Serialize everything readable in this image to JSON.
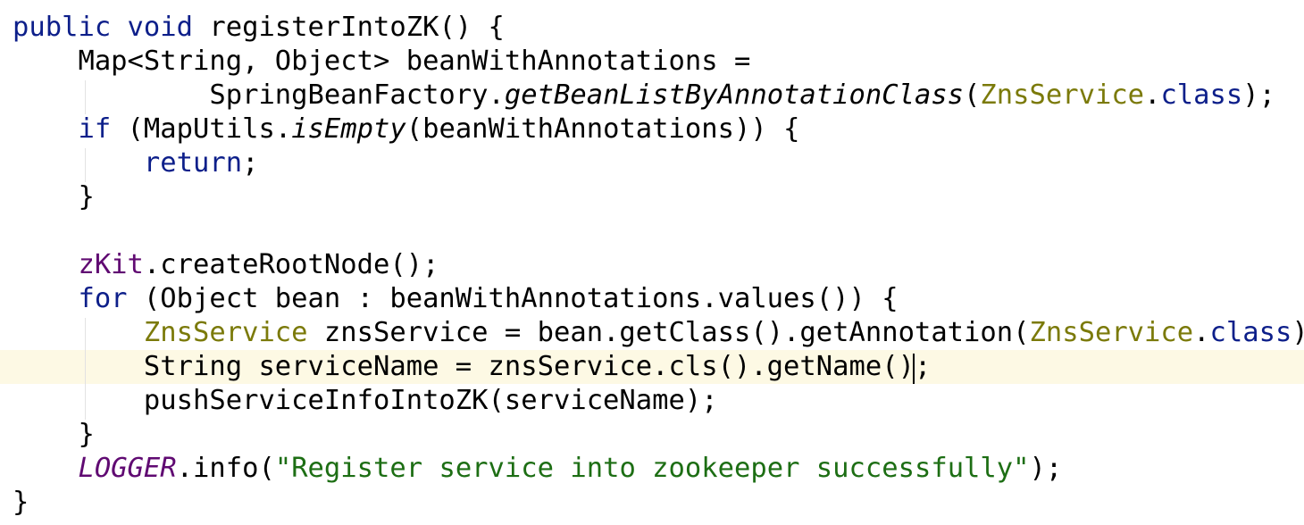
{
  "code_lines": [
    {
      "s": [
        {
          "t": "public void",
          "c": "kw"
        },
        {
          "t": " registerIntoZK() {",
          "c": ""
        }
      ]
    },
    {
      "s": [
        {
          "t": "    Map<String, Object> beanWithAnnotations =",
          "c": ""
        }
      ]
    },
    {
      "s": [
        {
          "t": "            SpringBeanFactory.",
          "c": ""
        },
        {
          "t": "getBeanListByAnnotationClass",
          "c": "it"
        },
        {
          "t": "(",
          "c": ""
        },
        {
          "t": "ZnsService",
          "c": "ann"
        },
        {
          "t": ".",
          "c": ""
        },
        {
          "t": "class",
          "c": "kw"
        },
        {
          "t": ");",
          "c": ""
        }
      ]
    },
    {
      "s": [
        {
          "t": "    ",
          "c": ""
        },
        {
          "t": "if",
          "c": "kw"
        },
        {
          "t": " (MapUtils.",
          "c": ""
        },
        {
          "t": "isEmpty",
          "c": "it"
        },
        {
          "t": "(beanWithAnnotations)) {",
          "c": ""
        }
      ]
    },
    {
      "s": [
        {
          "t": "        ",
          "c": ""
        },
        {
          "t": "return",
          "c": "kw"
        },
        {
          "t": ";",
          "c": ""
        }
      ]
    },
    {
      "s": [
        {
          "t": "    }",
          "c": ""
        }
      ]
    },
    {
      "s": [
        {
          "t": "",
          "c": ""
        }
      ]
    },
    {
      "s": [
        {
          "t": "    ",
          "c": ""
        },
        {
          "t": "zKit",
          "c": "field"
        },
        {
          "t": ".createRootNode();",
          "c": ""
        }
      ]
    },
    {
      "s": [
        {
          "t": "    ",
          "c": ""
        },
        {
          "t": "for",
          "c": "kw"
        },
        {
          "t": " (Object bean : beanWithAnnotations.values()) {",
          "c": ""
        }
      ]
    },
    {
      "s": [
        {
          "t": "        ",
          "c": ""
        },
        {
          "t": "ZnsService",
          "c": "ann"
        },
        {
          "t": " znsService = bean.getClass().getAnnotation(",
          "c": ""
        },
        {
          "t": "ZnsService",
          "c": "ann"
        },
        {
          "t": ".",
          "c": ""
        },
        {
          "t": "class",
          "c": "kw"
        },
        {
          "t": ");",
          "c": ""
        }
      ]
    },
    {
      "s": [
        {
          "t": "        String serviceName = znsService.cls().getName();",
          "c": ""
        }
      ],
      "current": true
    },
    {
      "s": [
        {
          "t": "        pushServiceInfoIntoZK(serviceName);",
          "c": ""
        }
      ]
    },
    {
      "s": [
        {
          "t": "    }",
          "c": ""
        }
      ]
    },
    {
      "s": [
        {
          "t": "    ",
          "c": ""
        },
        {
          "t": "LOGGER",
          "c": "field-it"
        },
        {
          "t": ".info(",
          "c": ""
        },
        {
          "t": "\"Register service into zookeeper successfully\"",
          "c": "str"
        },
        {
          "t": ");",
          "c": ""
        }
      ]
    },
    {
      "s": [
        {
          "t": "}",
          "c": ""
        }
      ]
    }
  ],
  "colors": {
    "keyword": "#0d1f8a",
    "annotation": "#7b7a0a",
    "string": "#1d6e14",
    "field": "#600a72",
    "current_line": "#fdf9e4"
  }
}
